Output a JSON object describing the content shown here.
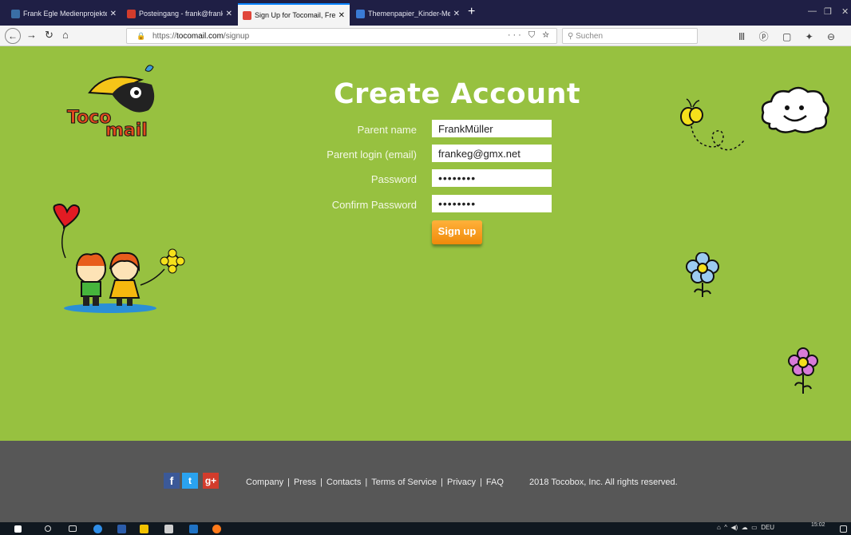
{
  "browser": {
    "tabs": [
      {
        "label": "Frank Egle Medienprojekte – Ki",
        "favicon_color": "#3a6ea5"
      },
      {
        "label": "Posteingang - frank@frankegle",
        "favicon_color": "#d23c2c"
      },
      {
        "label": "Sign Up for Tocomail, Free Ema",
        "favicon_color": "#e0463a",
        "active": true
      },
      {
        "label": "Themenpapier_Kinder-Messeng",
        "favicon_color": "#3a7bd5"
      }
    ],
    "url_prefix": "https://",
    "url_host": "tocomail.com",
    "url_path": "/signup",
    "url_actions": "··· ⛉ ☆",
    "search_placeholder": "Suchen",
    "toolbar_icons": "Ⅲ ⓟ ▢ ✦ ⊖ ≡"
  },
  "page": {
    "title": "Create Account",
    "form": {
      "parent_name_label": "Parent name",
      "parent_name_value": "FrankMüller",
      "email_label": "Parent login (email)",
      "email_value": "frankeg@gmx.net",
      "password_label": "Password",
      "password_value": "••••••••",
      "confirm_label": "Confirm Password",
      "confirm_value": "••••••••",
      "signup_label": "Sign up"
    }
  },
  "footer": {
    "social": [
      "f",
      "t",
      "g+"
    ],
    "links": [
      "Company",
      "Press",
      "Contacts",
      "Terms of Service",
      "Privacy",
      "FAQ"
    ],
    "copyright": "2018 Tocobox, Inc. All rights reserved."
  },
  "taskbar": {
    "tray_lang": "DEU",
    "time": "15:02"
  },
  "colors": {
    "page_bg": "#97c140",
    "footer_bg": "#575757",
    "button": "#f7a11a",
    "tab_bar": "#1f1f45"
  }
}
